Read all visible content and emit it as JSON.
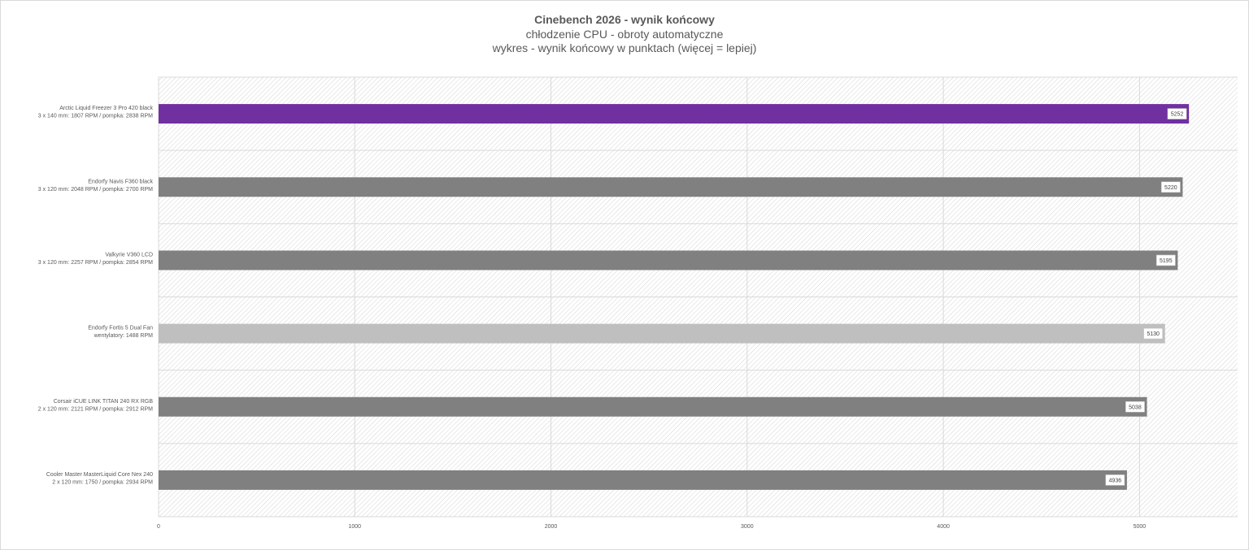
{
  "chart_data": {
    "type": "bar",
    "orientation": "horizontal",
    "title": "Cinebench 2026 - wynik końcowy",
    "subtitle": [
      "chłodzenie CPU - obroty automatyczne",
      "wykres - wynik końcowy w punktach (więcej = lepiej)"
    ],
    "categories": [
      [
        "Arctic Liquid Freezer 3 Pro 420 black",
        "3 x 140 mm: 1807  RPM / pompka: 2838 RPM"
      ],
      [
        "Endorfy Navis F360 black",
        "3 x 120 mm: 2048 RPM / pompka: 2700 RPM"
      ],
      [
        "Valkyrie V360 LCD",
        "3 x 120 mm: 2257 RPM / pompka: 2854 RPM"
      ],
      [
        "Endorfy Fortis 5 Dual Fan",
        "wentylatory: 1488 RPM"
      ],
      [
        "Corsair iCUE LINK TITAN 240 RX RGB",
        "2 x 120 mm: 2121 RPM / pompka: 2912 RPM"
      ],
      [
        "Cooler Master MasterLiquid Core Nex 240",
        "2 x 120 mm: 1750 / pompka: 2934 RPM"
      ]
    ],
    "values": [
      5252,
      5220,
      5195,
      5130,
      5038,
      4936
    ],
    "data_labels": [
      "5252",
      "5220",
      "5195",
      "5130",
      "5038",
      "4936"
    ],
    "bar_colors": [
      "#7030a0",
      "#808080",
      "#808080",
      "#bfbfbf",
      "#808080",
      "#808080"
    ],
    "xlim": [
      0,
      5500
    ],
    "x_ticks": [
      "0",
      "1000",
      "2000",
      "3000",
      "4000",
      "5000"
    ],
    "grid": true,
    "xlabel": "",
    "ylabel": ""
  }
}
